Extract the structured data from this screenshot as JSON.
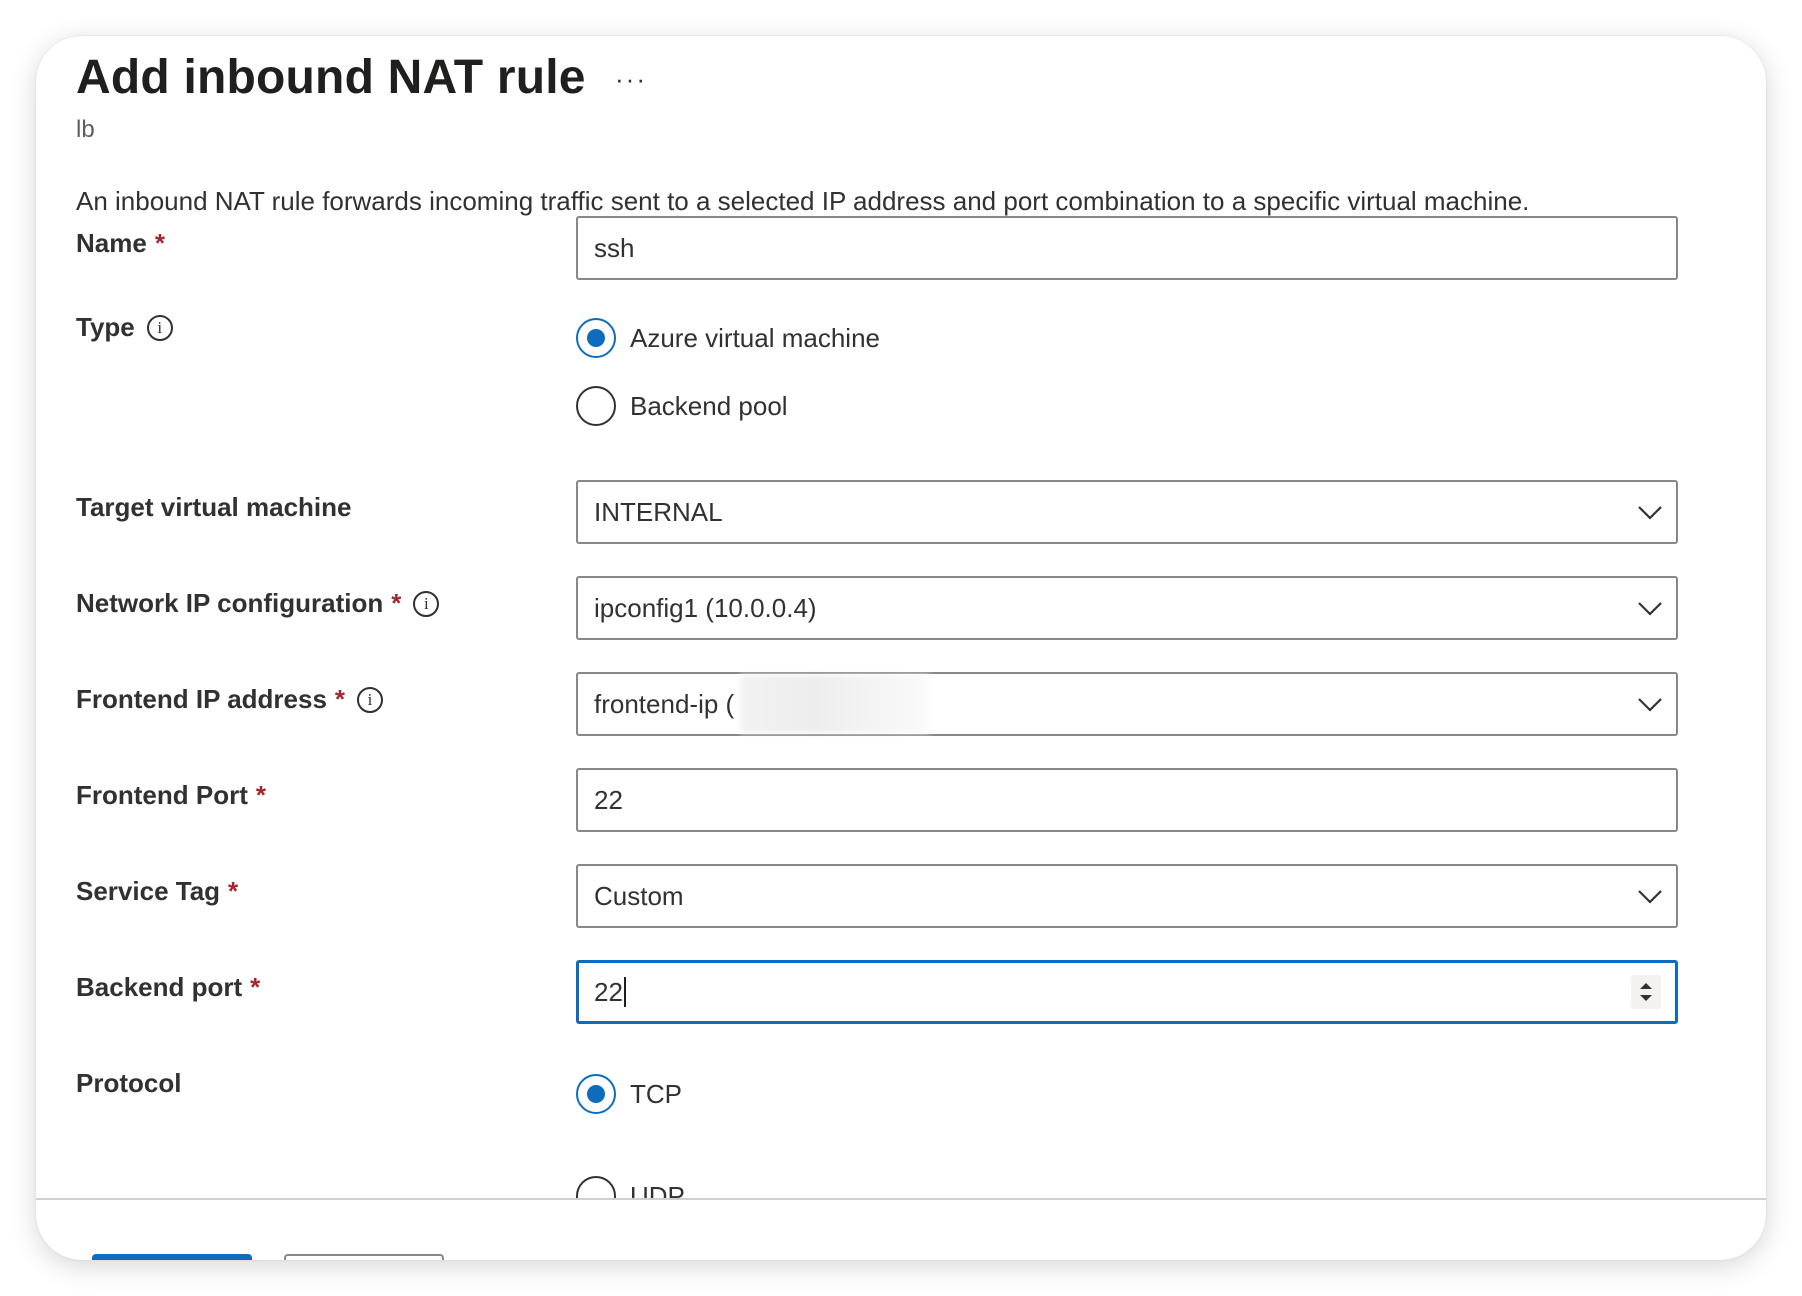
{
  "header": {
    "title": "Add inbound NAT rule",
    "more": "···",
    "subtitle": "lb"
  },
  "description": "An inbound NAT rule forwards incoming traffic sent to a selected IP address and port combination to a specific virtual machine.",
  "form": {
    "name": {
      "label": "Name",
      "required": "*",
      "value": "ssh"
    },
    "type": {
      "label": "Type",
      "info": "i",
      "options": [
        "Azure virtual machine",
        "Backend pool"
      ],
      "selected": "Azure virtual machine"
    },
    "target_vm": {
      "label": "Target virtual machine",
      "value": "INTERNAL"
    },
    "network_ip": {
      "label": "Network IP configuration",
      "required": "*",
      "info": "i",
      "value": "ipconfig1 (10.0.0.4)"
    },
    "frontend_ip": {
      "label": "Frontend IP address",
      "required": "*",
      "info": "i",
      "value": "frontend-ip ("
    },
    "frontend_port": {
      "label": "Frontend Port",
      "required": "*",
      "value": "22"
    },
    "service_tag": {
      "label": "Service Tag",
      "required": "*",
      "value": "Custom"
    },
    "backend_port": {
      "label": "Backend port",
      "required": "*",
      "value": "22"
    },
    "protocol": {
      "label": "Protocol",
      "options": [
        "TCP",
        "UDP"
      ],
      "selected": "TCP"
    }
  },
  "colors": {
    "accent": "#0f6cbd",
    "required": "#a4262c",
    "border": "#8a8886"
  },
  "icons": {
    "more": "ellipsis-icon",
    "info": "info-icon",
    "dropdown": "chevron-down-icon",
    "spin": "spin-button-icon"
  }
}
